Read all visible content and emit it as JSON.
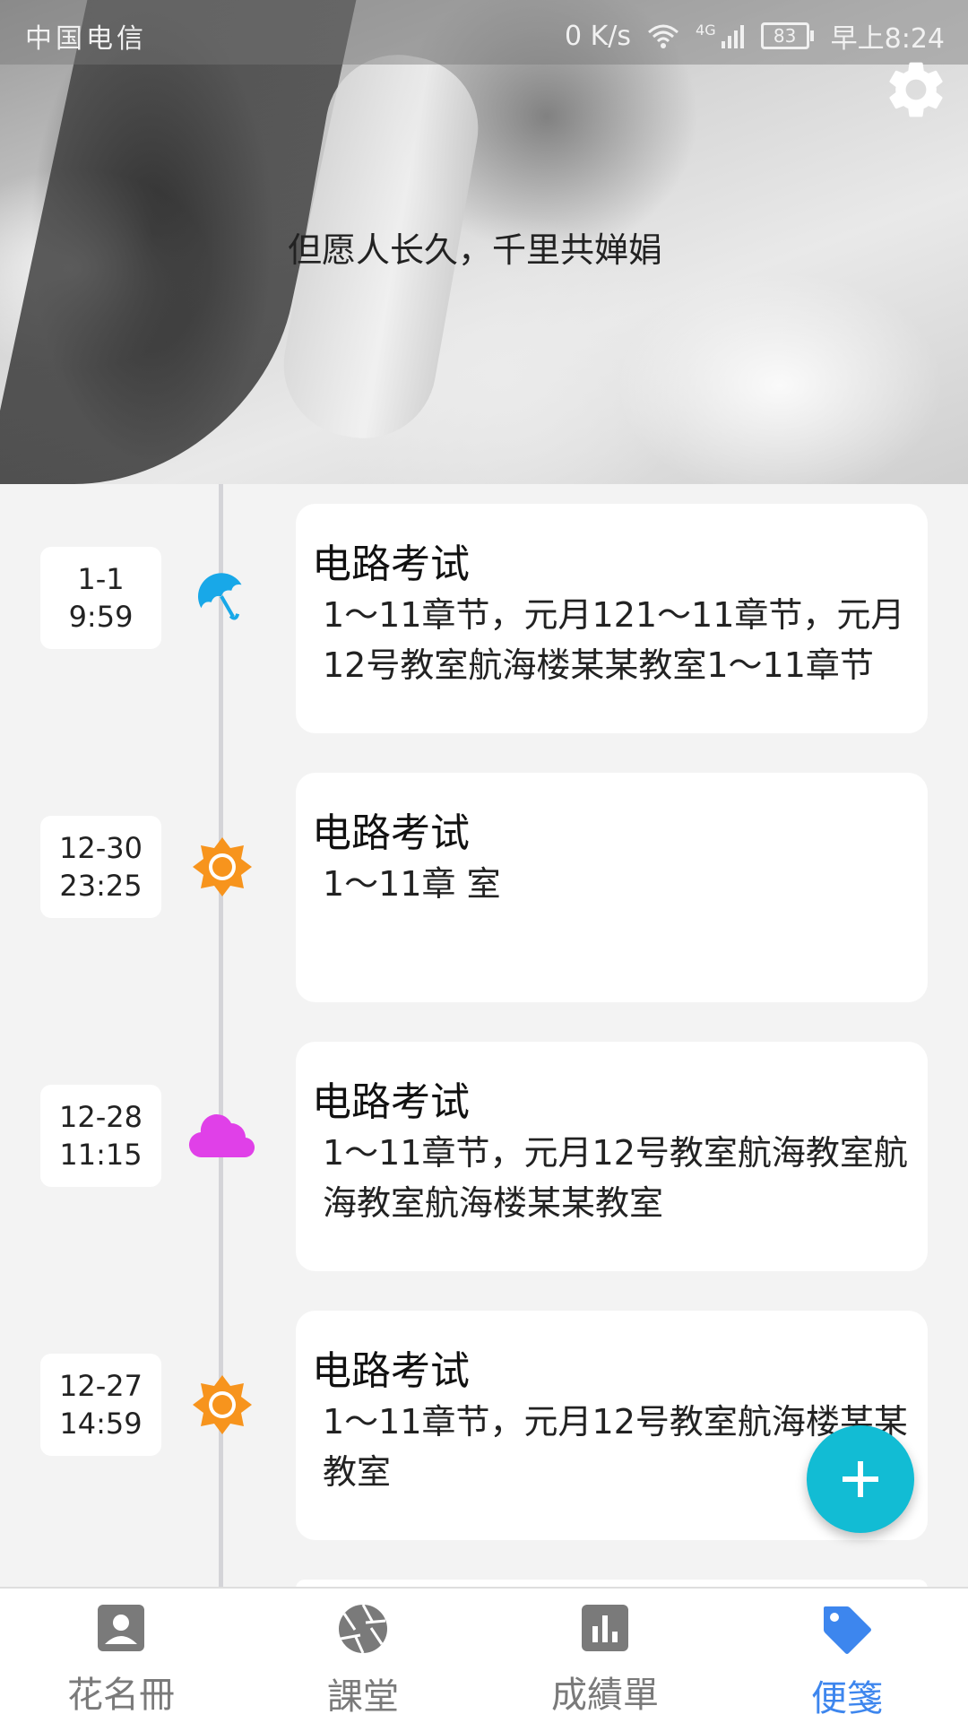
{
  "status_bar": {
    "carrier": "中国电信",
    "net_speed": "0 K/s",
    "network": "4G",
    "battery": "83",
    "time": "早上8:24"
  },
  "header": {
    "quote": "但愿人长久，千里共婵娟",
    "settings_icon": "gear-icon"
  },
  "notes": [
    {
      "date": "1-1",
      "time": "9:59",
      "weather": "umbrella",
      "title": "电路考试",
      "body": "1～11章节，元月121～11章节，元月12号教室航海楼某某教室1～11章节"
    },
    {
      "date": "12-30",
      "time": "23:25",
      "weather": "sunny",
      "title": "电路考试",
      "body": "1～11章 室"
    },
    {
      "date": "12-28",
      "time": "11:15",
      "weather": "cloudy",
      "title": "电路考试",
      "body": "1～11章节，元月12号教室航海教室航海教室航海楼某某教室"
    },
    {
      "date": "12-27",
      "time": "14:59",
      "weather": "sunny",
      "title": "电路考试",
      "body": "1～11章节，元月12号教室航海楼某某教室"
    }
  ],
  "fab": {
    "icon": "plus-icon"
  },
  "bottom_nav": [
    {
      "label": "花名冊",
      "icon": "contact-icon",
      "active": false
    },
    {
      "label": "課堂",
      "icon": "aperture-icon",
      "active": false
    },
    {
      "label": "成績單",
      "icon": "bar-chart-icon",
      "active": false
    },
    {
      "label": "便箋",
      "icon": "tag-icon",
      "active": true
    }
  ],
  "colors": {
    "accent": "#3d86ee",
    "fab": "#12bcd4",
    "sunny": "#f7941d",
    "cloudy": "#e040e8",
    "umbrella": "#18a8e8"
  }
}
